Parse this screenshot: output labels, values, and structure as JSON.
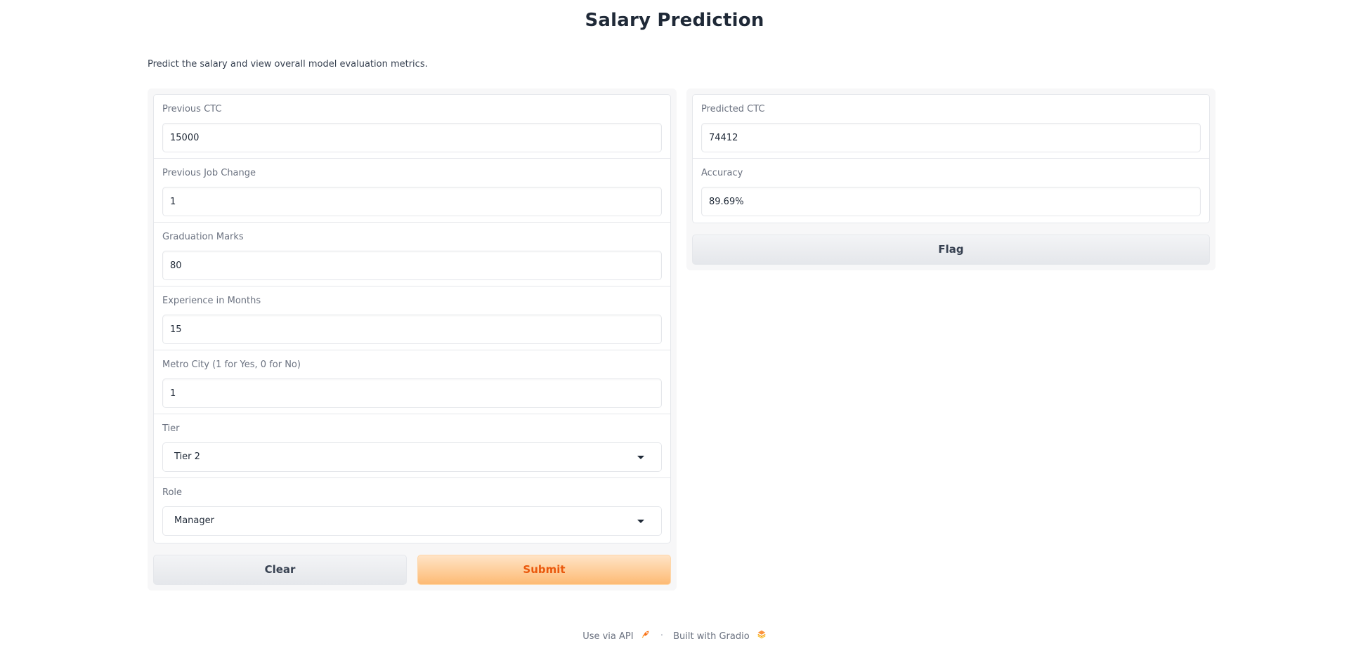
{
  "page": {
    "title": "Salary Prediction",
    "description": "Predict the salary and view overall model evaluation metrics."
  },
  "inputs": [
    {
      "label": "Previous CTC",
      "value": "15000"
    },
    {
      "label": "Previous Job Change",
      "value": "1"
    },
    {
      "label": "Graduation Marks",
      "value": "80"
    },
    {
      "label": "Experience in Months",
      "value": "15"
    },
    {
      "label": "Metro City (1 for Yes, 0 for No)",
      "value": "1"
    }
  ],
  "dropdowns": [
    {
      "label": "Tier",
      "value": "Tier 2"
    },
    {
      "label": "Role",
      "value": "Manager"
    }
  ],
  "outputs": [
    {
      "label": "Predicted CTC",
      "value": "74412"
    },
    {
      "label": "Accuracy",
      "value": "89.69%"
    }
  ],
  "buttons": {
    "clear": "Clear",
    "submit": "Submit",
    "flag": "Flag"
  },
  "footer": {
    "api": "Use via API",
    "separator": "·",
    "built": "Built with Gradio"
  },
  "colors": {
    "accent": "#ea580c",
    "accent_bg": "#fdba74"
  },
  "icons": {
    "api": "rocket-icon",
    "gradio": "gradio-logo-icon"
  }
}
